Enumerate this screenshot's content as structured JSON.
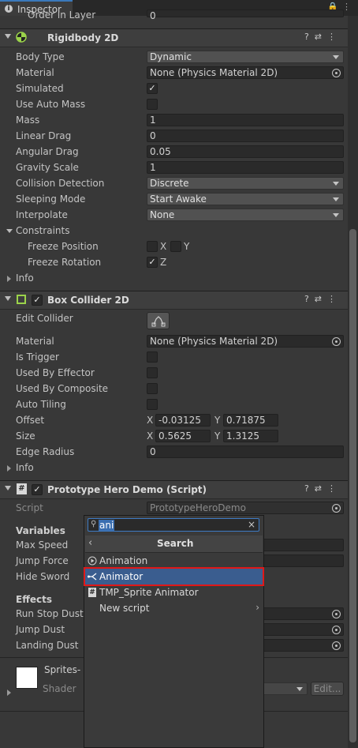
{
  "tab": {
    "title": "Inspector"
  },
  "top": {
    "cut_label": "Order in Layer",
    "cut_value": "0"
  },
  "rigidbody": {
    "title": "Rigidbody 2D",
    "body_type_label": "Body Type",
    "body_type_value": "Dynamic",
    "material_label": "Material",
    "material_value": "None (Physics Material 2D)",
    "simulated_label": "Simulated",
    "use_auto_mass_label": "Use Auto Mass",
    "mass_label": "Mass",
    "mass_value": "1",
    "linear_drag_label": "Linear Drag",
    "linear_drag_value": "0",
    "angular_drag_label": "Angular Drag",
    "angular_drag_value": "0.05",
    "gravity_scale_label": "Gravity Scale",
    "gravity_scale_value": "1",
    "collision_detection_label": "Collision Detection",
    "collision_detection_value": "Discrete",
    "sleeping_mode_label": "Sleeping Mode",
    "sleeping_mode_value": "Start Awake",
    "interpolate_label": "Interpolate",
    "interpolate_value": "None",
    "constraints_label": "Constraints",
    "freeze_position_label": "Freeze Position",
    "freeze_rotation_label": "Freeze Rotation",
    "x_label": "X",
    "y_label": "Y",
    "z_label": "Z",
    "info_label": "Info"
  },
  "box_collider": {
    "title": "Box Collider 2D",
    "edit_collider_label": "Edit Collider",
    "material_label": "Material",
    "material_value": "None (Physics Material 2D)",
    "is_trigger_label": "Is Trigger",
    "used_by_effector_label": "Used By Effector",
    "used_by_composite_label": "Used By Composite",
    "auto_tiling_label": "Auto Tiling",
    "offset_label": "Offset",
    "offset_x": "-0.03125",
    "offset_y": "0.71875",
    "size_label": "Size",
    "size_x": "0.5625",
    "size_y": "1.3125",
    "x_label": "X",
    "y_label": "Y",
    "edge_radius_label": "Edge Radius",
    "edge_radius_value": "0",
    "info_label": "Info"
  },
  "script": {
    "title": "Prototype Hero Demo (Script)",
    "script_label": "Script",
    "script_value": "PrototypeHeroDemo",
    "variables_label": "Variables",
    "max_speed_label": "Max Speed",
    "jump_force_label": "Jump Force",
    "hide_sword_label": "Hide Sword",
    "effects_label": "Effects",
    "run_stop_dust_label": "Run Stop Dust",
    "jump_dust_label": "Jump Dust",
    "landing_dust_label": "Landing Dust"
  },
  "material_section": {
    "name": "Sprites-",
    "shader_label": "Shader",
    "edit_button": "Edit..."
  },
  "popup": {
    "search_value": "ani",
    "header": "Search",
    "items": [
      "Animation",
      "Animator",
      "TMP_Sprite Animator",
      "New script"
    ]
  }
}
